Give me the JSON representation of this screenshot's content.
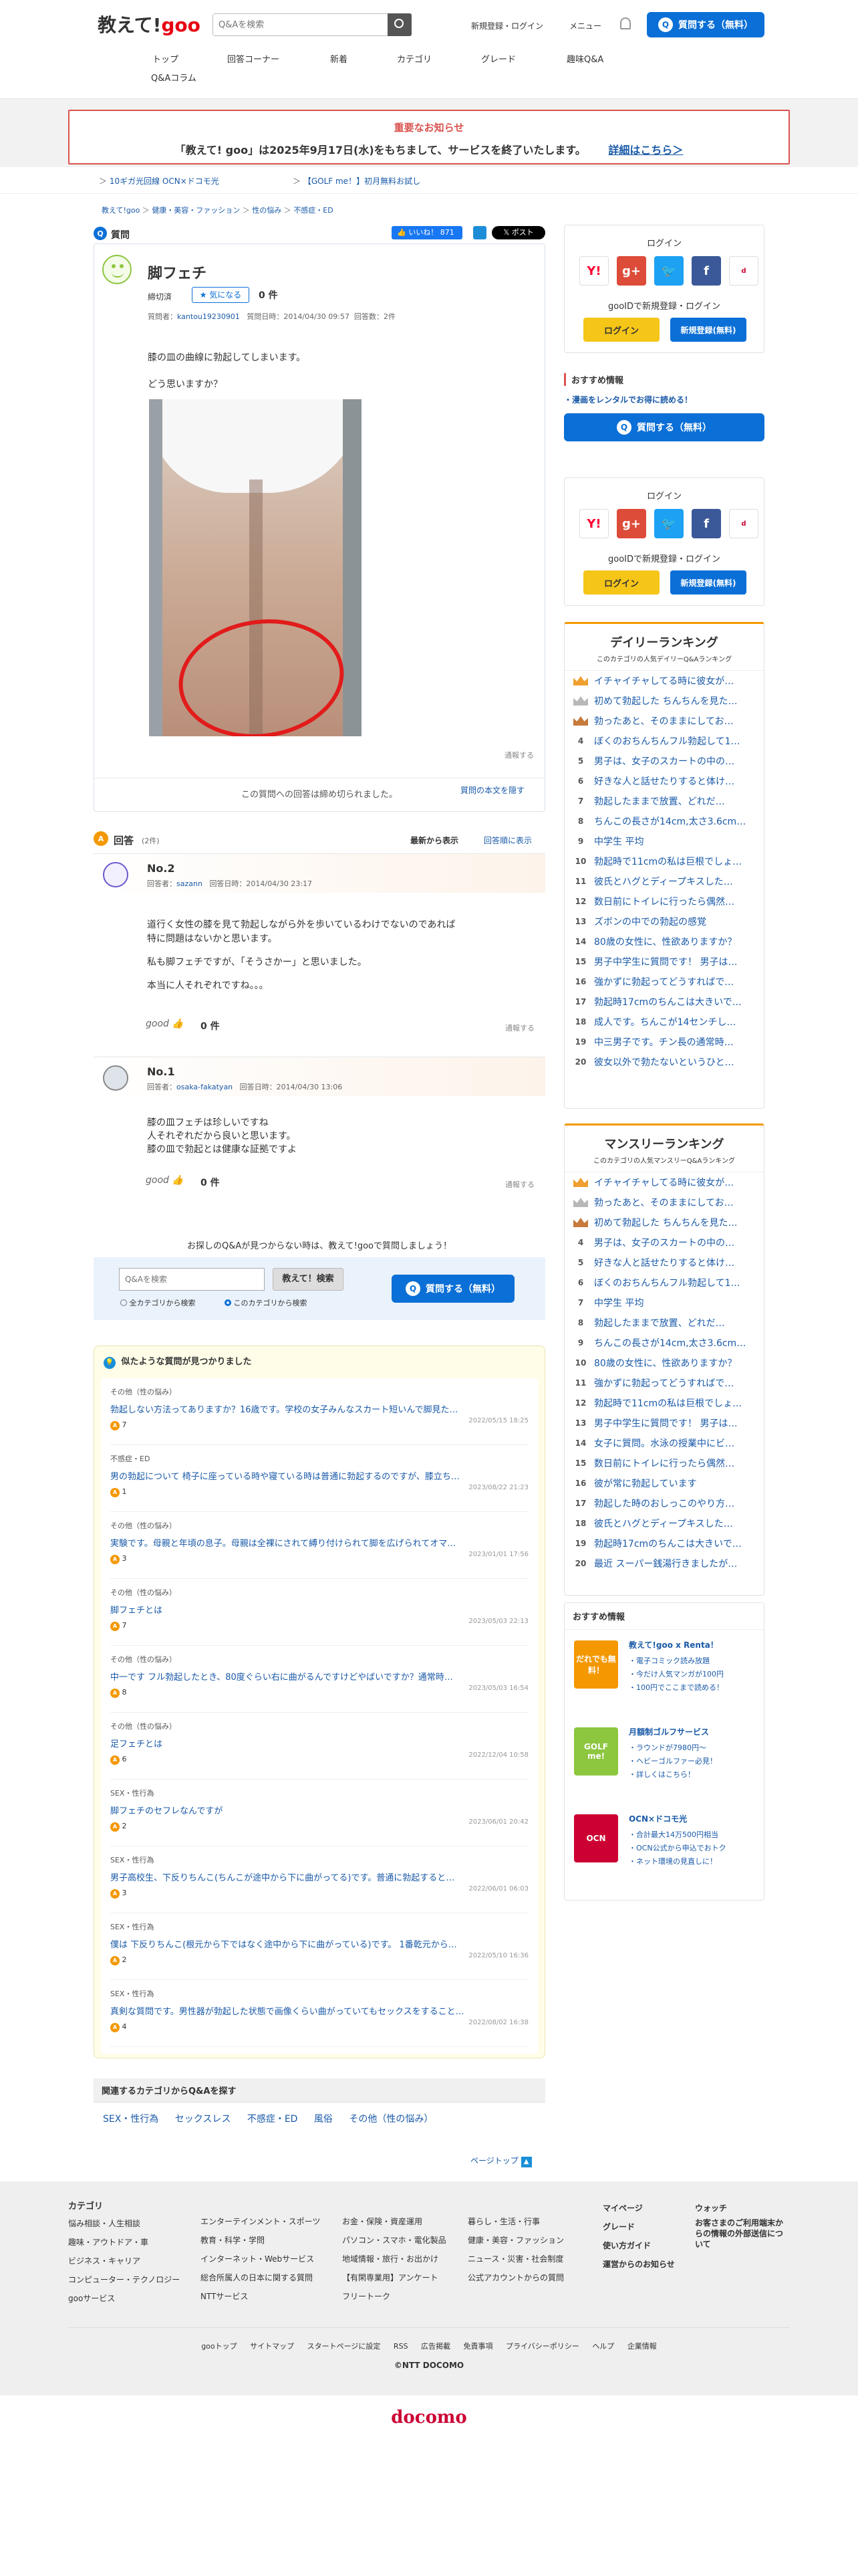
{
  "header": {
    "logo_a": "教えて!",
    "logo_b": "goo",
    "search_placeholder": "Q&Aを検索",
    "auth_link": "新規登録・ログイン",
    "menu": "メニュー",
    "ask_button": "質問する（無料）",
    "nav": [
      "トップ",
      "回答コーナー",
      "新着",
      "カテゴリ",
      "グレード",
      "趣味Q&A",
      "Q&Aコラム"
    ]
  },
  "notice": {
    "title": "重要なお知らせ",
    "body": "「教えて! goo」は2025年9月17日(水)をもちまして、サービスを終了いたします。",
    "link": "詳細はこちら＞"
  },
  "ads": [
    "10ギガ光回線 OCN×ドコモ光",
    "【GOLF me！】初月無料お試し"
  ],
  "breadcrumb": [
    "教えて!goo",
    "健康・美容・ファッション",
    "性の悩み",
    "不感症・ED"
  ],
  "question": {
    "section_label": "質問",
    "like_label": "いいね！",
    "like_count": "871",
    "post_label": "ポスト",
    "title": "脚フェチ",
    "status": "締切済",
    "follow": "気になる",
    "count": "0 件",
    "meta_user_label": "質問者：",
    "meta_user": "kantou19230901",
    "meta_date": "質問日時：2014/04/30 09:57",
    "meta_answers": "回答数：2件",
    "body1": "膝の皿の曲線に勃起してしまいます。",
    "body2": "どう思いますか？",
    "report": "通報する",
    "closed_note": "この質問への回答は締め切られました。",
    "hide_body": "質問の本文を隠す"
  },
  "answers_header": {
    "label": "回答",
    "count": "(2件)",
    "sort_new": "最新から表示",
    "sort_order": "回答順に表示"
  },
  "answers": [
    {
      "no": "No.2",
      "user_label": "回答者：",
      "user": "sazann",
      "date": "回答日時：2014/04/30 23:17",
      "l1": "道行く女性の膝を見て勃起しながら外を歩いているわけでないのであれば",
      "l2": "特に問題はないかと思います。",
      "l3": "私も脚フェチですが、「そうさかー」と思いました。",
      "l4": "本当に人それぞれですね。。。",
      "good": "good",
      "good_count": "0 件",
      "report": "通報する"
    },
    {
      "no": "No.1",
      "user_label": "回答者：",
      "user": "osaka-fakatyan",
      "date": "回答日時：2014/04/30 13:06",
      "l1": "膝の皿フェチは珍しいですね",
      "l2": "人それぞれだから良いと思います。",
      "l3": "膝の皿で勃起とは健康な証拠ですよ",
      "l4": "",
      "good": "good",
      "good_count": "0 件",
      "report": "通報する"
    }
  ],
  "ask_box": {
    "lead": "お探しのQ&Aが見つからない時は、教えて!gooで質問しましょう！",
    "placeholder": "Q&Aを検索",
    "search_button": "教えて！検索",
    "radio_all": "全カテゴリから検索",
    "radio_this": "このカテゴリから検索",
    "ask_button": "質問する（無料）"
  },
  "similar": {
    "title": "似たような質問が見つかりました",
    "items": [
      {
        "cat": "その他（性の悩み）",
        "text": "勃起しない方法ってありますか？16歳です。学校の女子みんなスカート短いんで脚見た…",
        "count": "7",
        "date": "2022/05/15 18:25"
      },
      {
        "cat": "不感症・ED",
        "text": "男の勃起について 椅子に座っている時や寝ている時は普通に勃起するのですが、膝立ち…",
        "count": "1",
        "date": "2023/08/22 21:23"
      },
      {
        "cat": "その他（性の悩み）",
        "text": "実験です。母親と年頃の息子。母親は全裸にされて縛り付けられて脚を広げられてオマ…",
        "count": "3",
        "date": "2023/01/01 17:56"
      },
      {
        "cat": "その他（性の悩み）",
        "text": "脚フェチとは",
        "count": "7",
        "date": "2023/05/03 22:13"
      },
      {
        "cat": "その他（性の悩み）",
        "text": "中一です フル勃起したとき、80度ぐらい右に曲がるんですけどやばいですか？通常時…",
        "count": "8",
        "date": "2023/05/03 16:54"
      },
      {
        "cat": "その他（性の悩み）",
        "text": "足フェチとは",
        "count": "6",
        "date": "2022/12/04 10:58"
      },
      {
        "cat": "SEX・性行為",
        "text": "脚フェチのセフレなんですが",
        "count": "2",
        "date": "2023/06/01 20:42"
      },
      {
        "cat": "SEX・性行為",
        "text": "男子高校生、下反りちんこ(ちんこが途中から下に曲がってる)です。普通に勃起すると…",
        "count": "3",
        "date": "2022/06/01 06:03"
      },
      {
        "cat": "SEX・性行為",
        "text": "僕は 下反りちんこ(根元から下ではなく途中から下に曲がっている)です。 1番乾元から…",
        "count": "2",
        "date": "2022/05/10 16:36"
      },
      {
        "cat": "SEX・性行為",
        "text": "真剣な質問です。男性器が勃起した状態で画像くらい曲がっていてもセックスをすること…",
        "count": "4",
        "date": "2022/08/02 16:38"
      }
    ]
  },
  "related": {
    "title": "関連するカテゴリからQ&Aを探す",
    "items": [
      "SEX・性行為",
      "セックスレス",
      "不感症・ED",
      "風俗",
      "その他（性の悩み）"
    ]
  },
  "page_top": "ページトップ",
  "sidebar": {
    "login_title": "ログイン",
    "login_caption": "gooIDで新規登録・ログイン",
    "login_btn": "ログイン",
    "register_btn": "新規登録(無料)",
    "reco_title": "おすすめ情報",
    "reco_link": "・漫画をレンタルでお得に読める！",
    "ask_button": "質問する（無料）",
    "daily_title": "デイリーランキング",
    "daily_sub": "このカテゴリの人気デイリーQ&Aランキング",
    "daily": [
      "イチャイチャしてる時に彼女が…",
      "初めて勃起した ちんちんを見た…",
      "勃ったあと、そのままにしてお…",
      "ぼくのおちんちんフル勃起して1…",
      "男子は、女子のスカートの中の…",
      "好きな人と話せたりすると体け…",
      "勃起したままで放置、どれだ…",
      "ちんこの長さが14cm,太さ3.6cm…",
      "中学生 平均",
      "勃起時で11cmの私は巨根でしょ…",
      "彼氏とハグとディープキスした…",
      "数日前にトイレに行ったら偶然…",
      "ズボンの中での勃起の感覚",
      "80歳の女性に、性欲ありますか？",
      "男子中学生に質問です！ 男子は…",
      "強かずに勃起ってどうすればで…",
      "勃起時17cmのちんこは大きいで…",
      "成人です。ちんこが14センチし…",
      "中三男子です。チン長の通常時…",
      "彼女以外で勃たないというひと…"
    ],
    "monthly_title": "マンスリーランキング",
    "monthly_sub": "このカテゴリの人気マンスリーQ&Aランキング",
    "monthly": [
      "イチャイチャしてる時に彼女が…",
      "勃ったあと、そのままにしてお…",
      "初めて勃起した ちんちんを見た…",
      "男子は、女子のスカートの中の…",
      "好きな人と話せたりすると体け…",
      "ぼくのおちんちんフル勃起して1…",
      "中学生 平均",
      "勃起したままで放置、どれだ…",
      "ちんこの長さが14cm,太さ3.6cm…",
      "80歳の女性に、性欲ありますか？",
      "強かずに勃起ってどうすればで…",
      "勃起時で11cmの私は巨根でしょ…",
      "男子中学生に質問です！ 男子は…",
      "女子に質問。水泳の授業中にビ…",
      "数日前にトイレに行ったら偶然…",
      "彼が常に勃起しています",
      "勃起した時のおしっこのやり方…",
      "彼氏とハグとディープキスした…",
      "勃起時17cmのちんこは大きいで…",
      "最近 スーパー銭湯行きましたが…"
    ],
    "promos": [
      {
        "title": "教えて!goo x Renta！",
        "l1": "・電子コミック読み放題",
        "l2": "・今だけ人気マンガが100円",
        "l3": "・100円でここまで読める！",
        "badge": "だれでも無料！"
      },
      {
        "title": "月額制ゴルフサービス",
        "l1": "・ラウンドが7980円～",
        "l2": "・ヘビーゴルファー必見！",
        "l3": "・詳しくはこちら！",
        "badge": "GOLF me!"
      },
      {
        "title": "OCN×ドコモ光",
        "l1": "・合計最大14万500円相当",
        "l2": "・OCN公式から申込でおトク",
        "l3": "・ネット環境の見直しに！",
        "badge": "OCN"
      }
    ]
  },
  "footer": {
    "col1_title": "カテゴリ",
    "col1": [
      "悩み相談・人生相談",
      "趣味・アウトドア・車",
      "ビジネス・キャリア",
      "コンピューター・テクノロジー",
      "gooサービス"
    ],
    "col2": [
      "エンターテインメント・スポーツ",
      "教育・科学・学問",
      "インターネット・Webサービス",
      "総合所属人の日本に関する質問",
      "NTTサービス"
    ],
    "col3": [
      "お金・保険・資産運用",
      "パソコン・スマホ・電化製品",
      "地域情報・旅行・お出かけ",
      "【有閑専業用】アンケート",
      "フリートーク"
    ],
    "col4": [
      "暮らし・生活・行事",
      "健康・美容・ファッション",
      "ニュース・災害・社会制度",
      "公式アカウントからの質問"
    ],
    "col5": [
      "マイページ",
      "グレード",
      "使い方ガイド",
      "運営からのお知らせ"
    ],
    "col6": [
      "ウォッチ",
      "お客さまのご利用端末からの情報の外部送信について"
    ],
    "links": [
      "gooトップ",
      "サイトマップ",
      "スタートページに設定",
      "RSS",
      "広告掲載",
      "免責事項",
      "プライバシーポリシー",
      "ヘルプ",
      "企業情報"
    ],
    "copyright": "©NTT DOCOMO",
    "docomo": "docomo"
  }
}
